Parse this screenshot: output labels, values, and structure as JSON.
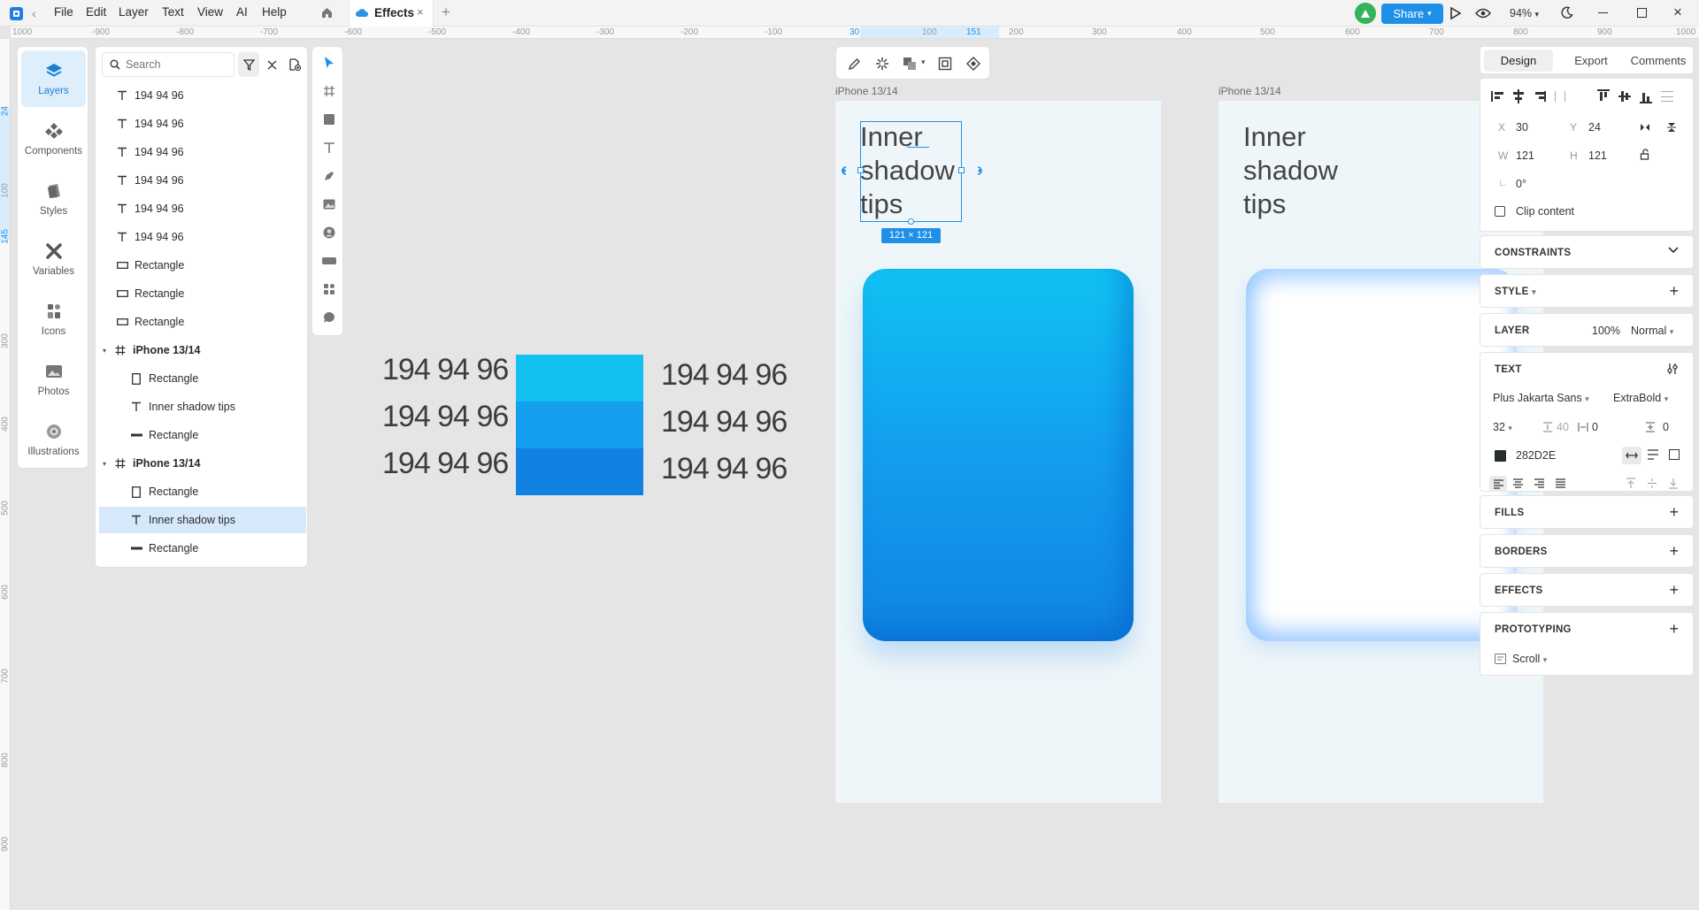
{
  "app": {
    "menu": [
      "File",
      "Edit",
      "Layer",
      "Text",
      "View",
      "AI",
      "Help"
    ],
    "tab_title": "Effects",
    "share_label": "Share",
    "zoom": "94%",
    "colors": {
      "accent": "#1e90e8",
      "avatar": "#33b35a"
    }
  },
  "ruler": {
    "top": [
      "1000",
      "-900",
      "-800",
      "-700",
      "-600",
      "-500",
      "-400",
      "-300",
      "-200",
      "-100",
      "30",
      "100",
      "151",
      "200",
      "300",
      "400",
      "500",
      "600",
      "700",
      "800",
      "900",
      "1000"
    ],
    "left": [
      "24",
      "100",
      "145",
      "300",
      "400",
      "500",
      "600",
      "700",
      "800",
      "900"
    ]
  },
  "nav": [
    {
      "label": "Layers",
      "icon": "layers-icon"
    },
    {
      "label": "Components",
      "icon": "components-icon"
    },
    {
      "label": "Styles",
      "icon": "styles-icon"
    },
    {
      "label": "Variables",
      "icon": "variables-icon"
    },
    {
      "label": "Icons",
      "icon": "icons-icon"
    },
    {
      "label": "Photos",
      "icon": "photos-icon"
    },
    {
      "label": "Illustrations",
      "icon": "illustrations-icon"
    }
  ],
  "layers": {
    "search_placeholder": "Search",
    "items": [
      {
        "label": "194 94 96",
        "type": "text"
      },
      {
        "label": "194 94 96",
        "type": "text"
      },
      {
        "label": "194 94 96",
        "type": "text"
      },
      {
        "label": "194 94 96",
        "type": "text"
      },
      {
        "label": "194 94 96",
        "type": "text"
      },
      {
        "label": "194 94 96",
        "type": "text"
      },
      {
        "label": "Rectangle",
        "type": "rect"
      },
      {
        "label": "Rectangle",
        "type": "rect"
      },
      {
        "label": "Rectangle",
        "type": "rect"
      },
      {
        "label": "iPhone 13/14",
        "type": "frame"
      },
      {
        "label": "Rectangle",
        "type": "rect-tall"
      },
      {
        "label": "Inner  shadow tips",
        "type": "text"
      },
      {
        "label": "Rectangle",
        "type": "line"
      },
      {
        "label": "iPhone 13/14",
        "type": "frame"
      },
      {
        "label": "Rectangle",
        "type": "rect-tall"
      },
      {
        "label": "Inner  shadow tips",
        "type": "text",
        "selected": true
      },
      {
        "label": "Rectangle",
        "type": "line"
      }
    ]
  },
  "canvas": {
    "swatch_labels_left": [
      "194 94 96",
      "194 94 96",
      "194 94 96"
    ],
    "swatch_labels_right": [
      "194 94 96",
      "194 94 96",
      "194 94 96"
    ],
    "swatch_colors": [
      "#12c0f2",
      "#139fee",
      "#1282e2"
    ],
    "frames": [
      {
        "label": "iPhone 13/14",
        "heading": [
          "Inner",
          "shadow",
          "tips"
        ]
      },
      {
        "label": "iPhone 13/14",
        "heading": [
          "Inner",
          "shadow",
          "tips"
        ]
      }
    ],
    "selection_size": "121 × 121"
  },
  "inspector": {
    "tabs": [
      "Design",
      "Export",
      "Comments"
    ],
    "x": "30",
    "y": "24",
    "w": "121",
    "h": "121",
    "rotation": "0°",
    "clip_content": "Clip content",
    "sections": {
      "constraints": "CONSTRAINTS",
      "style": "STYLE",
      "layer": "LAYER",
      "text": "TEXT",
      "fills": "FILLS",
      "borders": "BORDERS",
      "effects": "EFFECTS",
      "prototyping": "PROTOTYPING"
    },
    "layer_opacity": "100%",
    "blend_mode": "Normal",
    "font_family": "Plus Jakarta Sans",
    "font_weight": "ExtraBold",
    "font_size": "32",
    "line_height": "40",
    "letter_spacing": "0",
    "paragraph_spacing": "0",
    "text_color": "282D2E",
    "scroll": "Scroll"
  }
}
